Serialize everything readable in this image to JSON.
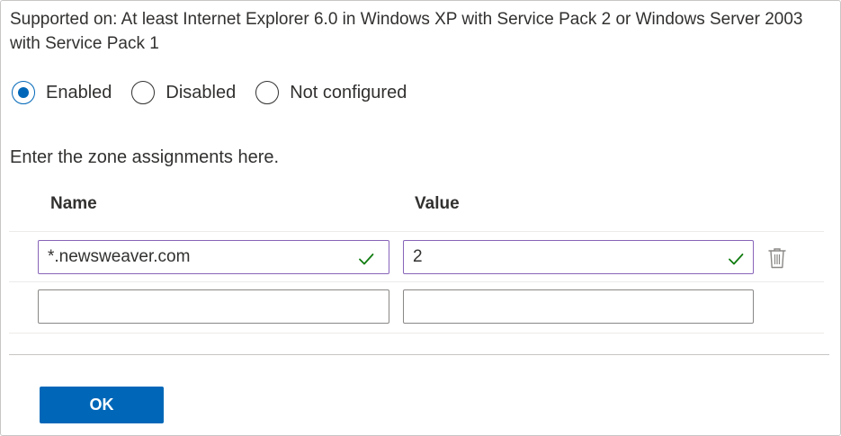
{
  "supported_on": "Supported on: At least Internet Explorer 6.0 in Windows XP with Service Pack 2 or Windows Server 2003 with Service Pack 1",
  "state": {
    "options": [
      {
        "label": "Enabled",
        "checked": true
      },
      {
        "label": "Disabled",
        "checked": false
      },
      {
        "label": "Not configured",
        "checked": false
      }
    ]
  },
  "zone_section": {
    "intro": "Enter the zone assignments here.",
    "headers": {
      "name": "Name",
      "value": "Value"
    },
    "rows": [
      {
        "name": "*.newsweaver.com",
        "value": "2",
        "valid": true
      },
      {
        "name": "",
        "value": "",
        "valid": false
      }
    ]
  },
  "footer": {
    "ok_label": "OK"
  },
  "colors": {
    "accent": "#0067b8",
    "valid_border": "#8764b8",
    "valid_check": "#107c10"
  },
  "icons": {
    "valid": "check-icon",
    "delete": "trash-icon"
  }
}
